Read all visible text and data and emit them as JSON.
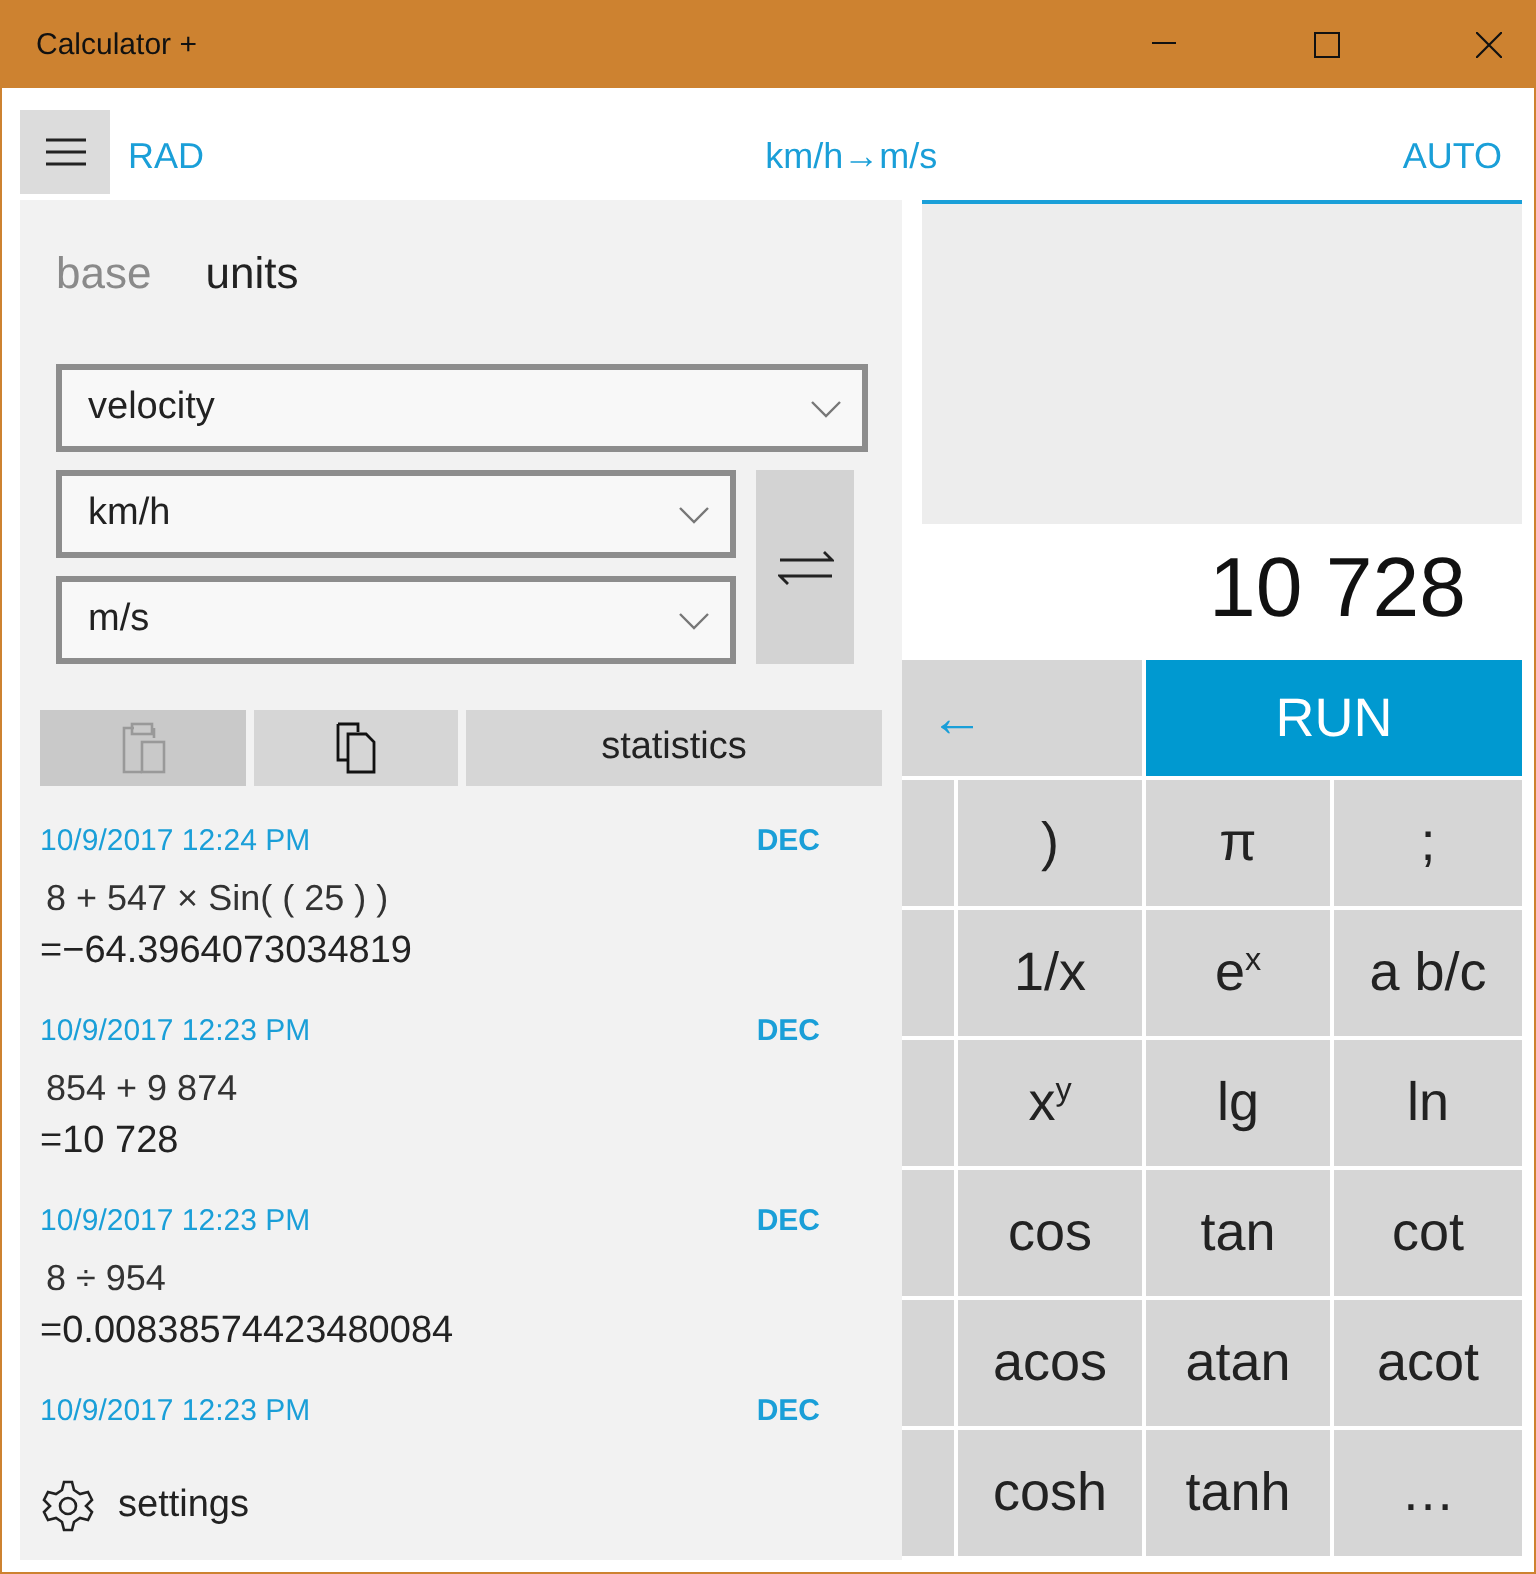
{
  "window": {
    "title": "Calculator +"
  },
  "toolbar": {
    "angle_mode": "RAD",
    "conversion": "km/h→m/s",
    "mode": "AUTO"
  },
  "panel": {
    "tabs": [
      {
        "label": "base",
        "selected": false
      },
      {
        "label": "units",
        "selected": true
      }
    ],
    "category": "velocity",
    "from_unit": "km/h",
    "to_unit": "m/s",
    "actions": [
      {
        "kind": "paste",
        "disabled": true
      },
      {
        "kind": "copy",
        "disabled": false
      },
      {
        "kind": "text",
        "label": "statistics",
        "disabled": false
      }
    ],
    "history": [
      {
        "time": "10/9/2017 12:24 PM",
        "base": "DEC",
        "expression": "8 + 547 × Sin( ( 25 ) )",
        "result": "=−64.3964073034819"
      },
      {
        "time": "10/9/2017 12:23 PM",
        "base": "DEC",
        "expression": "854 + 9 874",
        "result": "=10 728"
      },
      {
        "time": "10/9/2017 12:23 PM",
        "base": "DEC",
        "expression": "8 ÷ 954",
        "result": "=0.00838574423480084"
      },
      {
        "time": "10/9/2017 12:23 PM",
        "base": "DEC"
      }
    ],
    "settings_label": "settings"
  },
  "display": {
    "value": "10 728"
  },
  "keypad": {
    "backspace": "←",
    "run": "RUN",
    "rows": [
      [
        ")",
        "π",
        ";"
      ],
      [
        "1/x",
        "e$^{x}$",
        "a b/c"
      ],
      [
        "x$^{y}$",
        "lg",
        "ln"
      ],
      [
        "cos",
        "tan",
        "cot"
      ],
      [
        "acos",
        "atan",
        "acot"
      ],
      [
        "cosh",
        "tanh",
        "…"
      ]
    ]
  }
}
